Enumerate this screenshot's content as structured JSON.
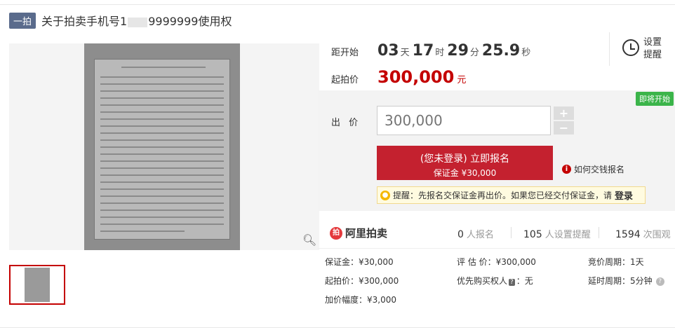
{
  "title": {
    "badge": "一拍",
    "prefix": "关于拍卖手机号1",
    "suffix": "9999999使用权"
  },
  "countdown": {
    "label": "距开始",
    "days": "03",
    "days_unit": "天",
    "hours": "17",
    "hours_unit": "时",
    "minutes": "29",
    "minutes_unit": "分",
    "seconds": "25.9",
    "seconds_unit": "秒"
  },
  "start_price": {
    "label": "起拍价",
    "value": "300,000",
    "unit": "元"
  },
  "reminder": {
    "line1": "设置",
    "line2": "提醒"
  },
  "bid": {
    "status_badge": "即将开始",
    "label": "出 价",
    "input_placeholder": "300,000",
    "plus": "+",
    "minus": "−",
    "register_line1": "(您未登录) 立即报名",
    "register_line2": "保证金 ¥30,000",
    "howto": "如何交钱报名",
    "tip_text": "提醒：先报名交保证金再出价。如果您已经交付保证金，请",
    "tip_login": "登录"
  },
  "stats": {
    "logo_text": "阿里拍卖",
    "signups_num": "0",
    "signups_label": "人报名",
    "reminders_num": "105",
    "reminders_label": "人设置提醒",
    "views_num": "1594",
    "views_label": "次围观"
  },
  "details": {
    "deposit": "保证金：¥30,000",
    "appraisal": "评 估 价：¥300,000",
    "cycle": "竞价周期：1天",
    "start_price": "起拍价：¥300,000",
    "priority_label": "优先购买权人",
    "priority_tag": "?",
    "priority_value": "：无",
    "delay": "延时周期：5分钟",
    "increment": "加价幅度：¥3,000"
  }
}
